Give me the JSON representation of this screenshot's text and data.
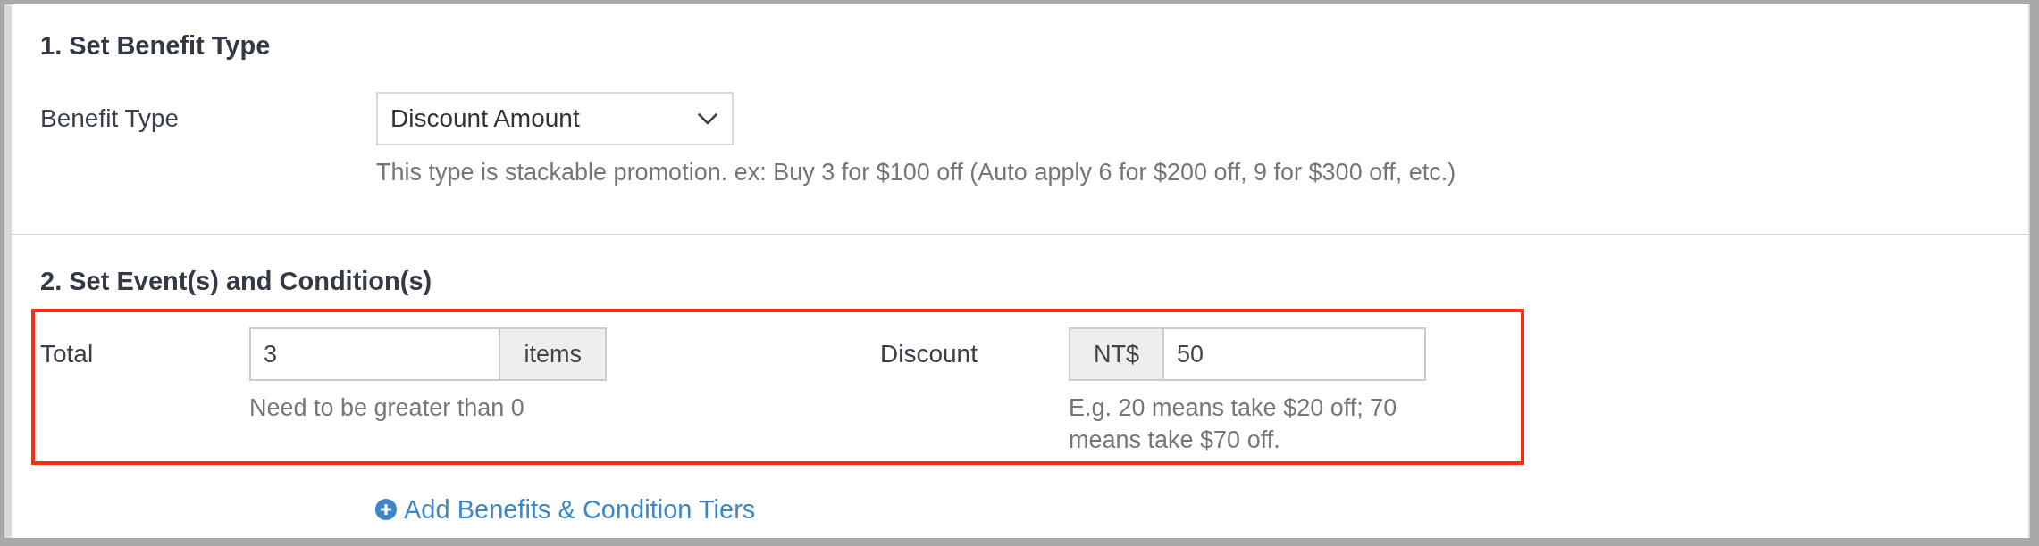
{
  "benefit_type_section": {
    "title": "1. Set Benefit Type",
    "field": {
      "label": "Benefit Type",
      "value": "Discount Amount",
      "help": "This type is stackable promotion. ex: Buy 3 for $100 off (Auto apply 6 for $200 off, 9 for $300 off, etc.)"
    }
  },
  "conditions_section": {
    "title": "2. Set Event(s) and Condition(s)",
    "highlighted": true,
    "fields": [
      {
        "kind": "suffix",
        "label": "Total",
        "value": "3",
        "addon": "items",
        "help": "Need to be greater than 0"
      },
      {
        "kind": "prefix",
        "label": "Discount",
        "addon": "NT$",
        "value": "50",
        "help": "E.g. 20 means take $20 off; 70 means take $70 off."
      }
    ],
    "add_link": "Add Benefits & Condition Tiers"
  }
}
